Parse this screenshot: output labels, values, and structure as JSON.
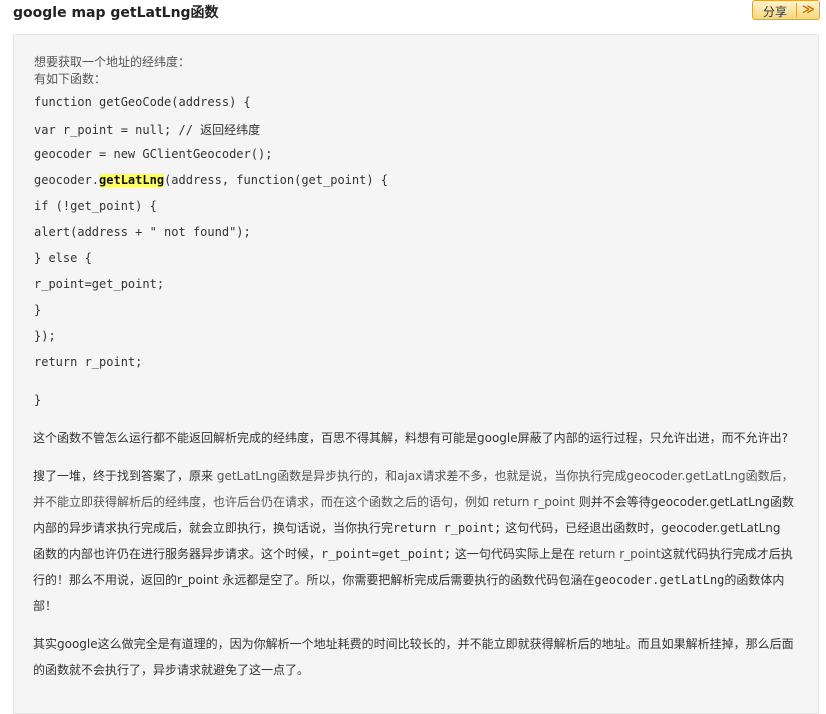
{
  "header": {
    "title": "google map getLatLng函数",
    "share_label": "分享",
    "share_arrow": "≫"
  },
  "intro": {
    "line1": "想要获取一个地址的经纬度：",
    "line2": "有如下函数："
  },
  "code": {
    "l1": "function getGeoCode(address) {",
    "l2": "var r_point = null; // 返回经纬度",
    "l3": "geocoder = new GClientGeocoder();",
    "l4_pre": "geocoder.",
    "l4_hl": "getLatLng",
    "l4_post": "(address, function(get_point) {",
    "l5": "if (!get_point) {",
    "l6": "alert(address + \" not found\");",
    "l7": "} else {",
    "l8": "r_point=get_point;",
    "l9": "}",
    "l10": "});",
    "l11": "return r_point;",
    "l12": "}"
  },
  "paragraphs": {
    "p1": "这个函数不管怎么运行都不能返回解析完成的经纬度，百思不得其解，料想有可能是google屏蔽了内部的运行过程，只允许出进，而不允许出?",
    "p2_a": "搜了一堆，终于找到答案了，原来 ",
    "p2_b": "getLatLng函数是异步执行的，和ajax请求差不多，也就是说，当你执行完成geocoder.getLatLng函数后，并不能立即获得解析后的经纬度，也许后台仍在请求，而在这个函数之后的语句，例如 ",
    "p2_c": "return r_point",
    "p2_d": " 则并不会等待geocoder.getLatLng函数内部的异步请求执行完成后，就会立即执行，换句话说，当你执行完",
    "p2_e": "return r_point;",
    "p2_f": " 这句代码，已经退出函数时，geocoder.getLatLng 函数的内部也许仍在进行服务器异步请求。这个时候，",
    "p2_g": "r_point=get_point;",
    "p2_h": " 这一句代码实际上是在 ",
    "p2_i": "return r_point",
    "p2_j": "这就代码执行完成才后执行的！那么不用说，返回的r_point 永远都是空了。所以，你需要把解析完成后需要执行的函数代码包涵在",
    "p2_k": "geocoder.getLatLng",
    "p2_l": "的函数体内部！",
    "p3": "其实google这么做完全是有道理的，因为你解析一个地址耗费的时间比较长的，并不能立即就获得解析后的地址。而且如果解析挂掉，那么后面的函数就不会执行了，异步请求就避免了这一点了。"
  }
}
